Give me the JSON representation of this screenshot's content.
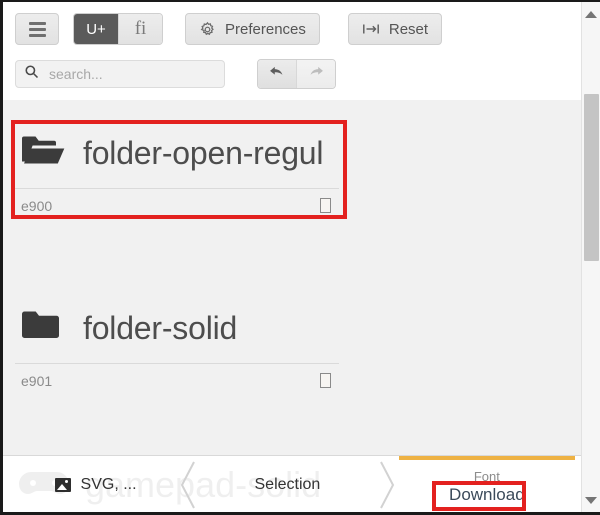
{
  "header": {
    "menu_button": {
      "icon": "hamburger-icon"
    },
    "mode_toggle": {
      "options": [
        {
          "label": "U+",
          "name": "unicode-mode",
          "active": true
        },
        {
          "label": "fi",
          "name": "ligature-mode",
          "active": false
        }
      ]
    },
    "preferences_label": "Preferences",
    "reset_label": "Reset",
    "search": {
      "placeholder": "search...",
      "value": "",
      "icon": "search-icon"
    },
    "history": {
      "undo_icon": "undo-arrow-icon",
      "redo_icon": "redo-arrow-icon"
    }
  },
  "content": {
    "icons": [
      {
        "name": "folder-open-regul",
        "code": "e900",
        "glyph": "folder-open-icon",
        "selected": true
      },
      {
        "name": "folder-solid",
        "code": "e901",
        "glyph": "folder-solid-icon",
        "selected": false
      }
    ]
  },
  "watermark": {
    "label": "gamepad-solid",
    "icon": "gamepad-icon"
  },
  "bottombar": {
    "steps": [
      {
        "label": "SVG, ...",
        "icon": "image-icon",
        "name": "step-svg"
      },
      {
        "label": "Selection",
        "name": "step-selection"
      }
    ],
    "font_step": {
      "title": "Font",
      "action": "Download",
      "accent_color": "#eeb244"
    }
  },
  "scrollbar": {
    "up_arrow": "scroll-up-icon",
    "down_arrow": "scroll-down-icon"
  },
  "highlight_color": "#e3211f"
}
